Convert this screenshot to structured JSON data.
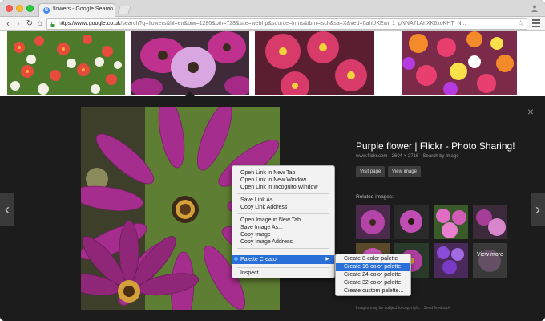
{
  "browser": {
    "tab_title": "flowers - Google Search",
    "tab_favicon": "G",
    "tab_close": "×",
    "url_host": "https://www.google.co.uk",
    "url_rest": "/search?q=flowers&hl=en&biw=1280&bih=728&site=webhp&source=lnms&tbm=isch&sa=X&ved=0ahUKEwi_1_pNNA7LAhXK6xoKHT_N...",
    "back_icon": "‹",
    "forward_icon": "›",
    "reload_icon": "↻",
    "home_icon": "⌂",
    "star_icon": "☆"
  },
  "preview": {
    "title": "Purple flower | Flickr - Photo Sharing!",
    "meta": "www.flickr.com · 2604 × 2716 · Search by image",
    "visit_button": "Visit page",
    "view_button": "View image",
    "related_label": "Related images:",
    "view_more": "View more",
    "footer_note": "Images may be subject to copyright. · Send feedback",
    "close_icon": "×",
    "prev_icon": "‹",
    "next_icon": "›"
  },
  "context_menu": {
    "items": [
      "Open Link in New Tab",
      "Open Link in New Window",
      "Open Link in Incognito Window",
      "Save Link As...",
      "Copy Link Address",
      "Open Image in New Tab",
      "Save Image As...",
      "Copy Image",
      "Copy Image Address",
      "Palette Creator",
      "Inspect"
    ],
    "submenu_arrow": "▶"
  },
  "submenu": {
    "items": [
      "Create 8-color palette",
      "Create 16-color palette",
      "Create 24-color palette",
      "Create 32-color palette",
      "Create custom palette..."
    ]
  },
  "colors": {
    "highlight": "#2a6ed8",
    "panel_bg": "#1c1c1c"
  }
}
